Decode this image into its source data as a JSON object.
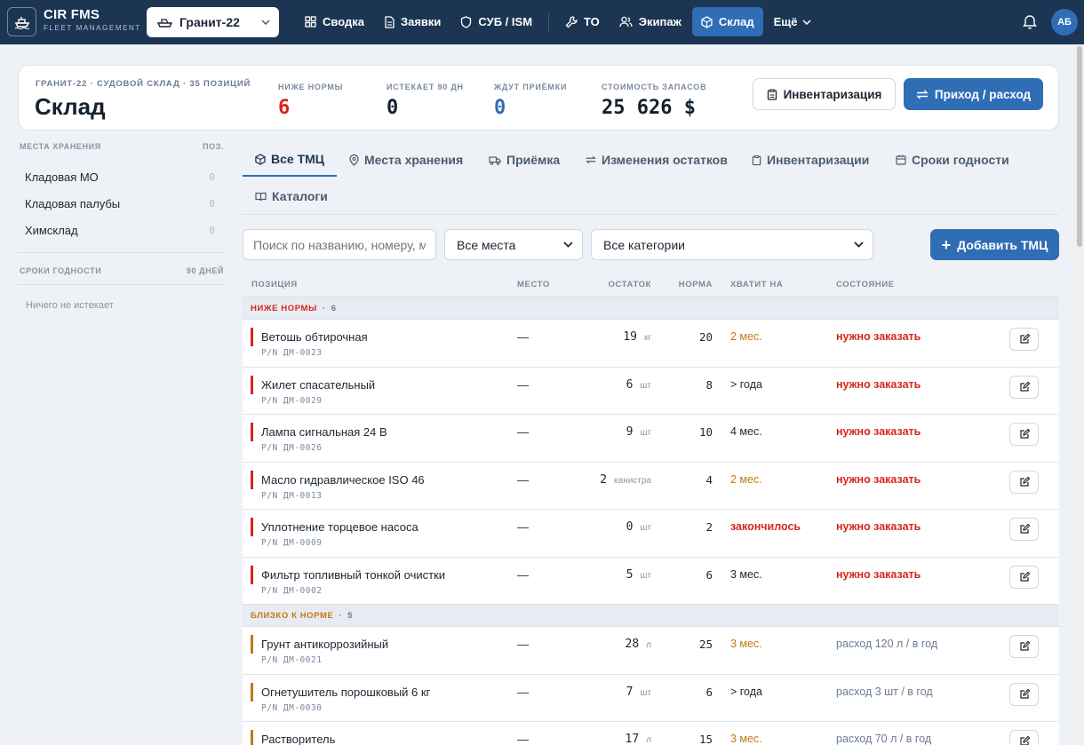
{
  "brand": {
    "title": "CIR FMS",
    "subtitle": "FLEET MANAGEMENT"
  },
  "vessel": {
    "selected": "Гранит-22"
  },
  "nav": [
    {
      "label": "Сводка",
      "icon": "grid-icon"
    },
    {
      "label": "Заявки",
      "icon": "document-icon"
    },
    {
      "label": "СУБ / ISM",
      "icon": "shield-icon"
    },
    {
      "label": "ТО",
      "icon": "wrench-icon"
    },
    {
      "label": "Экипаж",
      "icon": "users-icon"
    },
    {
      "label": "Склад",
      "icon": "box-icon",
      "active": true
    },
    {
      "label": "Ещё",
      "icon": "chevron-down-icon"
    }
  ],
  "user": {
    "initials": "АБ"
  },
  "header": {
    "crumb": "ГРАНИТ-22 · СУДОВОЙ СКЛАД · 35 ПОЗИЦИЙ",
    "title": "Склад",
    "stats": [
      {
        "label": "НИЖЕ НОРМЫ",
        "value": "6",
        "color": "#d7261c"
      },
      {
        "label": "ИСТЕКАЕТ 90 ДН",
        "value": "0",
        "color": "#14202e"
      },
      {
        "label": "ЖДУТ ПРИЁМКИ",
        "value": "0",
        "color": "#2f6db5"
      },
      {
        "label": "СТОИМОСТЬ ЗАПАСОВ",
        "value": "25 626 $",
        "color": "#14202e"
      }
    ],
    "btn_inventory": "Инвентаризация",
    "btn_movement": "Приход / расход"
  },
  "sidebar": {
    "storage_header": "МЕСТА ХРАНЕНИЯ",
    "storage_count_header": "ПОЗ.",
    "storage": [
      {
        "label": "Кладовая МО",
        "count": "0"
      },
      {
        "label": "Кладовая палубы",
        "count": "0"
      },
      {
        "label": "Химсклад",
        "count": "0"
      }
    ],
    "expiry_header": "СРОКИ ГОДНОСТИ",
    "expiry_days": "90 ДНЕЙ",
    "expiry_empty": "Ничего не истекает"
  },
  "tabs": [
    {
      "label": "Все ТМЦ",
      "icon": "box-icon",
      "active": true
    },
    {
      "label": "Места хранения",
      "icon": "pin-icon"
    },
    {
      "label": "Приёмка",
      "icon": "truck-icon"
    },
    {
      "label": "Изменения остатков",
      "icon": "swap-icon"
    },
    {
      "label": "Инвентаризации",
      "icon": "clipboard-icon"
    },
    {
      "label": "Сроки годности",
      "icon": "calendar-icon"
    },
    {
      "label": "Каталоги",
      "icon": "book-icon"
    }
  ],
  "filters": {
    "search_placeholder": "Поиск по названию, номеру, м",
    "place": "Все места",
    "category": "Все категории",
    "add_label": "Добавить ТМЦ"
  },
  "table": {
    "columns": [
      "ПОЗИЦИЯ",
      "МЕСТО",
      "ОСТАТОК",
      "НОРМА",
      "ХВАТИТ НА",
      "СОСТОЯНИЕ"
    ],
    "groups": [
      {
        "label": "НИЖЕ НОРМЫ",
        "count": "6",
        "color": "#d7261c",
        "rows": [
          {
            "name": "Ветошь обтирочная",
            "pn": "P/N ДМ-0023",
            "place": "—",
            "qty": "19",
            "unit": "кг",
            "norm": "20",
            "enough": "2 мес.",
            "enough_color": "#c27a12",
            "state": "нужно заказать",
            "state_color": "#d7261c",
            "state_bold": true
          },
          {
            "name": "Жилет спасательный",
            "pn": "P/N ДМ-0029",
            "place": "—",
            "qty": "6",
            "unit": "шт",
            "norm": "8",
            "enough": "> года",
            "enough_color": "#1c2633",
            "state": "нужно заказать",
            "state_color": "#d7261c",
            "state_bold": true
          },
          {
            "name": "Лампа сигнальная 24 В",
            "pn": "P/N ДМ-0026",
            "place": "—",
            "qty": "9",
            "unit": "шт",
            "norm": "10",
            "enough": "4 мес.",
            "enough_color": "#1c2633",
            "state": "нужно заказать",
            "state_color": "#d7261c",
            "state_bold": true
          },
          {
            "name": "Масло гидравлическое ISO 46",
            "pn": "P/N ДМ-0013",
            "place": "—",
            "qty": "2",
            "unit": "канистра",
            "norm": "4",
            "enough": "2 мес.",
            "enough_color": "#c27a12",
            "state": "нужно заказать",
            "state_color": "#d7261c",
            "state_bold": true
          },
          {
            "name": "Уплотнение торцевое насоса",
            "pn": "P/N ДМ-0009",
            "place": "—",
            "qty": "0",
            "unit": "шт",
            "norm": "2",
            "enough": "закончилось",
            "enough_color": "#d7261c",
            "enough_bold": true,
            "state": "нужно заказать",
            "state_color": "#d7261c",
            "state_bold": true
          },
          {
            "name": "Фильтр топливный тонкой очистки",
            "pn": "P/N ДМ-0002",
            "place": "—",
            "qty": "5",
            "unit": "шт",
            "norm": "6",
            "enough": "3 мес.",
            "enough_color": "#1c2633",
            "state": "нужно заказать",
            "state_color": "#d7261c",
            "state_bold": true
          }
        ]
      },
      {
        "label": "БЛИЗКО К НОРМЕ",
        "count": "5",
        "color": "#c27a12",
        "rows": [
          {
            "name": "Грунт антикоррозийный",
            "pn": "P/N ДМ-0021",
            "place": "—",
            "qty": "28",
            "unit": "л",
            "norm": "25",
            "enough": "3 мес.",
            "enough_color": "#c27a12",
            "state": "расход 120 л / в год",
            "state_color": "#6b7b8f"
          },
          {
            "name": "Огнетушитель порошковый 6 кг",
            "pn": "P/N ДМ-0030",
            "place": "—",
            "qty": "7",
            "unit": "шт",
            "norm": "6",
            "enough": "> года",
            "enough_color": "#1c2633",
            "state": "расход 3 шт / в год",
            "state_color": "#6b7b8f"
          },
          {
            "name": "Растворитель",
            "pn": "",
            "place": "—",
            "qty": "17",
            "unit": "л",
            "norm": "15",
            "enough": "3 мес.",
            "enough_color": "#c27a12",
            "state": "расход 70 л / в год",
            "state_color": "#6b7b8f"
          }
        ]
      }
    ]
  }
}
